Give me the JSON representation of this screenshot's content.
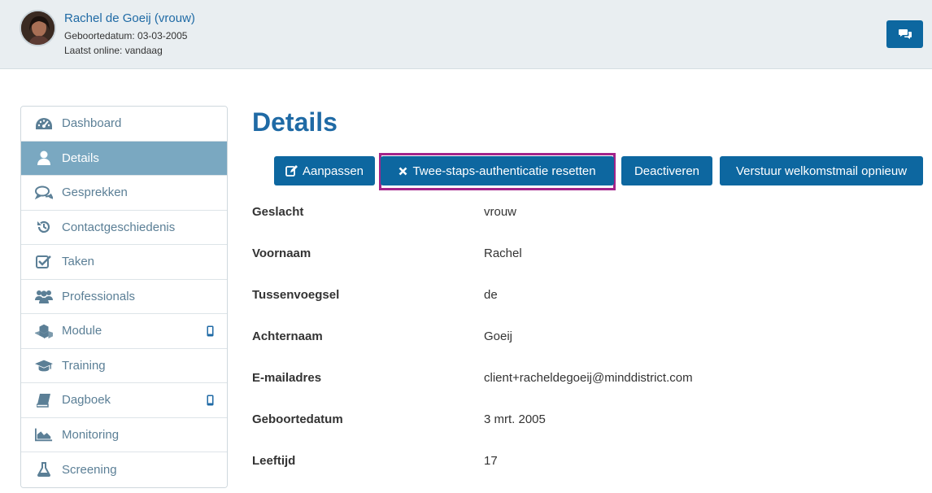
{
  "header": {
    "user_name": "Rachel de Goeij (vrouw)",
    "birthdate_line": "Geboortedatum: 03-03-2005",
    "last_online_line": "Laatst online: vandaag"
  },
  "sidebar": {
    "items": [
      {
        "label": "Dashboard",
        "icon": "dashboard-icon"
      },
      {
        "label": "Details",
        "icon": "user-icon",
        "active": true
      },
      {
        "label": "Gesprekken",
        "icon": "chat-bubbles-icon"
      },
      {
        "label": "Contactgeschiedenis",
        "icon": "history-icon"
      },
      {
        "label": "Taken",
        "icon": "checkbox-icon"
      },
      {
        "label": "Professionals",
        "icon": "users-icon"
      },
      {
        "label": "Module",
        "icon": "cubes-icon",
        "mobile": true
      },
      {
        "label": "Training",
        "icon": "graduation-cap-icon"
      },
      {
        "label": "Dagboek",
        "icon": "book-icon",
        "mobile": true
      },
      {
        "label": "Monitoring",
        "icon": "area-chart-icon"
      },
      {
        "label": "Screening",
        "icon": "flask-icon"
      }
    ]
  },
  "main": {
    "title": "Details",
    "buttons": {
      "edit": "Aanpassen",
      "reset_2fa": "Twee-staps-authenticatie resetten",
      "deactivate": "Deactiveren",
      "resend_welcome": "Verstuur welkomstmail opnieuw"
    },
    "details": [
      {
        "label": "Geslacht",
        "value": "vrouw"
      },
      {
        "label": "Voornaam",
        "value": "Rachel"
      },
      {
        "label": "Tussenvoegsel",
        "value": "de"
      },
      {
        "label": "Achternaam",
        "value": "Goeij"
      },
      {
        "label": "E-mailadres",
        "value": "client+racheldegoeij@minddistrict.com"
      },
      {
        "label": "Geboortedatum",
        "value": "3 mrt. 2005"
      },
      {
        "label": "Leeftijd",
        "value": "17"
      }
    ]
  },
  "colors": {
    "primary": "#0d67a0",
    "title": "#1f6aa5",
    "sidebar_active": "#7aa8c1",
    "sidebar_text": "#5b7f96",
    "highlight": "#a3248a",
    "header_bg": "#e9eef1"
  }
}
